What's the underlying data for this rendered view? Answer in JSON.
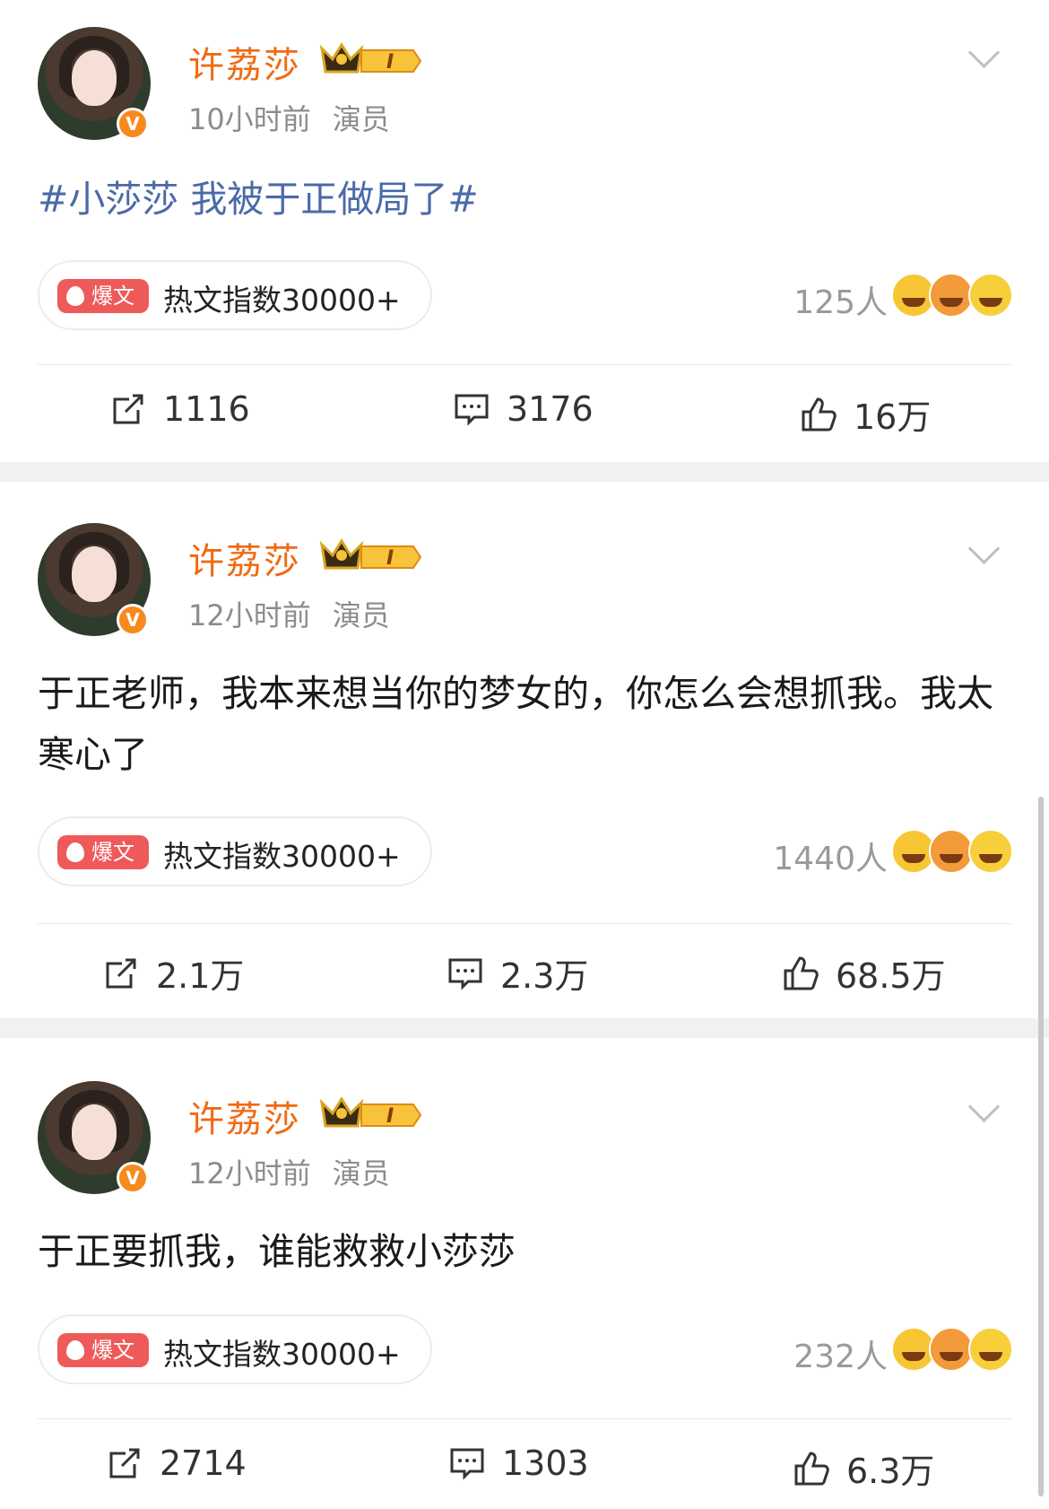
{
  "posts": [
    {
      "author": "许荔莎",
      "level": "I",
      "time": "10小时前",
      "role": "演员",
      "text": "#小莎莎 我被于正做局了#",
      "is_topic": true,
      "hot_tag": "爆文",
      "hot_label": "热文指数30000+",
      "reaction_count": "125人",
      "reposts": "1116",
      "comments": "3176",
      "likes": "16万"
    },
    {
      "author": "许荔莎",
      "level": "I",
      "time": "12小时前",
      "role": "演员",
      "text": "于正老师，我本来想当你的梦女的，你怎么会想抓我。我太寒心了",
      "is_topic": false,
      "hot_tag": "爆文",
      "hot_label": "热文指数30000+",
      "reaction_count": "1440人",
      "reposts": "2.1万",
      "comments": "2.3万",
      "likes": "68.5万"
    },
    {
      "author": "许荔莎",
      "level": "I",
      "time": "12小时前",
      "role": "演员",
      "text": "于正要抓我，谁能救救小莎莎",
      "is_topic": false,
      "hot_tag": "爆文",
      "hot_label": "热文指数30000+",
      "reaction_count": "232人",
      "reposts": "2714",
      "comments": "1303",
      "likes": "6.3万"
    }
  ],
  "colors": {
    "name": "#f06a12",
    "topic": "#4a6aa8",
    "hot_tag": "#ee5a5a",
    "verified": "#f78a1e"
  },
  "icons": {
    "repost": "repost-icon",
    "comment": "comment-icon",
    "like": "thumbs-up-icon",
    "more": "chevron-down-icon"
  }
}
